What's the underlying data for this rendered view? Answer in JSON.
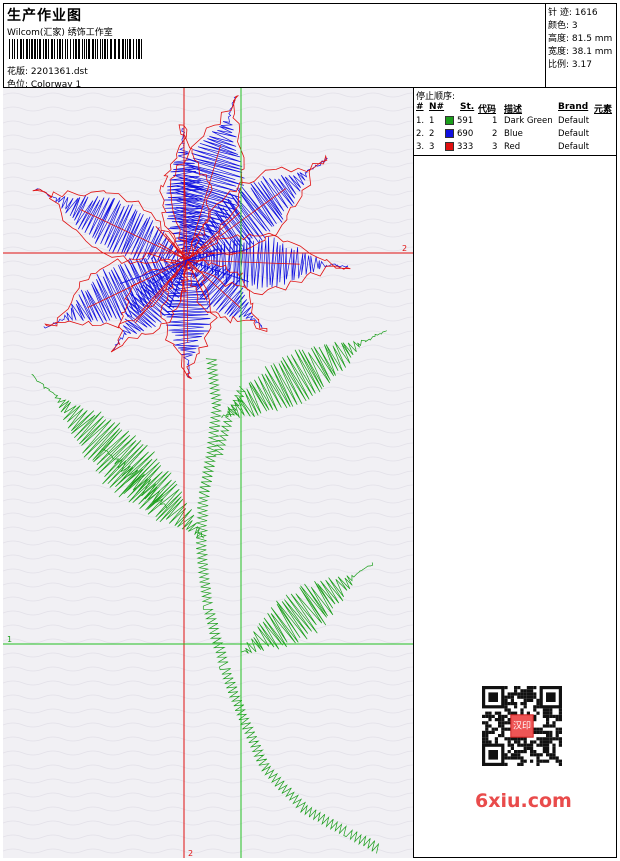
{
  "header": {
    "title": "生产作业图",
    "company": "Wilcom(汇家) 绣饰工作室",
    "design_label": "花版: 2201361.dst",
    "colorway_label": "色位: Colorway 1"
  },
  "stats": {
    "stitches": "针 迹: 1616",
    "colors": "颜色: 3",
    "height": "高度: 81.5 mm",
    "width": "宽度: 38.1 mm",
    "ratio": "比例: 3.17"
  },
  "guides": {
    "h_top_label": "2",
    "h_bottom_label": "1",
    "v_bottom_label": "2"
  },
  "stop_sequence": {
    "title": "停止顺序:",
    "headers": [
      "#",
      "N#",
      "St.",
      "代码",
      "描述",
      "Brand",
      "元素"
    ],
    "rows": [
      {
        "idx": "1.",
        "n": "1",
        "st": "591",
        "code": "1",
        "desc": "Dark Green",
        "brand": "Default",
        "color": "#1a9e1a"
      },
      {
        "idx": "2.",
        "n": "2",
        "st": "690",
        "code": "2",
        "desc": "Blue",
        "brand": "Default",
        "color": "#1010e0"
      },
      {
        "idx": "3.",
        "n": "3",
        "st": "333",
        "code": "3",
        "desc": "Red",
        "brand": "Default",
        "color": "#e01010"
      }
    ]
  },
  "watermark": {
    "text": "6xiu.com",
    "seal_text": "汉印"
  },
  "colors": {
    "green": "#1a9e1a",
    "blue": "#1010e0",
    "red": "#e01010",
    "guide_red": "#e01010",
    "guide_green": "#22c022"
  }
}
